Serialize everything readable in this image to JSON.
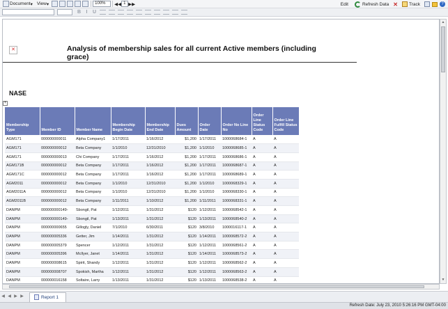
{
  "toolbar": {
    "document_label": "Document",
    "view_label": "View",
    "zoom_value": "100%",
    "page_number": "1",
    "edit_label": "Edit",
    "refresh_label": "Refresh Data",
    "track_label": "Track"
  },
  "report": {
    "title": "Analysis of membership sales for all current Active members (including grace)",
    "group_label": "NASE",
    "columns": [
      "Membership Type",
      "Member ID",
      "Member Name",
      "Membership Begin Date",
      "Membership End Date",
      "Dues Amount",
      "Order Date",
      "Order No Line No",
      "Order Line Status Code",
      "Order Line Fulfill Status Code"
    ],
    "rows": [
      [
        "AGM171",
        "000000000011",
        "Alpha Company1",
        "1/17/2011",
        "1/16/2012",
        "$1,200",
        "1/17/2011",
        "1000068684-1",
        "A",
        "A"
      ],
      [
        "AGM171",
        "000000000012",
        "Beta Company",
        "1/1/2010",
        "12/31/2010",
        "$1,200",
        "1/1/2010",
        "1000068685-1",
        "A",
        "A"
      ],
      [
        "AGM171",
        "000000000013",
        "Chi Company",
        "1/17/2011",
        "1/16/2012",
        "$1,200",
        "1/17/2011",
        "1000068686-1",
        "A",
        "A"
      ],
      [
        "AGM171B",
        "000000000012",
        "Beta Company",
        "1/17/2011",
        "1/16/2012",
        "$1,200",
        "1/17/2011",
        "1000068687-1",
        "A",
        "A"
      ],
      [
        "AGM171C",
        "000000000012",
        "Beta Company",
        "1/17/2011",
        "1/16/2012",
        "$1,200",
        "1/17/2011",
        "1000068689-1",
        "A",
        "A"
      ],
      [
        "AGM2011",
        "000000000012",
        "Beta Company",
        "1/1/2010",
        "12/31/2010",
        "$1,200",
        "1/1/2010",
        "1000068329-1",
        "A",
        "A"
      ],
      [
        "AGM2011A",
        "000000000012",
        "Beta Company",
        "1/1/2010",
        "12/31/2010",
        "$1,200",
        "1/1/2010",
        "1000068330-1",
        "A",
        "A"
      ],
      [
        "AGM2011B",
        "000000000012",
        "Beta Company",
        "1/11/2011",
        "1/10/2012",
        "$1,200",
        "1/11/2011",
        "1000068331-1",
        "A",
        "A"
      ],
      [
        "DANPM",
        "000000000149-",
        "Sbongil, Pat",
        "1/12/2011",
        "1/31/2012",
        "$120",
        "1/12/2011",
        "1000068542-1",
        "A",
        "A"
      ],
      [
        "DANPM",
        "000000000149-",
        "Sbongil, Pat",
        "1/13/2011",
        "1/31/2012",
        "$120",
        "1/13/2011",
        "1000068540-2",
        "A",
        "A"
      ],
      [
        "DANPM",
        "000000000655",
        "Gillogly, Daniel",
        "7/1/2010",
        "6/30/2011",
        "$120",
        "3/8/2010",
        "1000016117-1",
        "A",
        "A"
      ],
      [
        "DANPM",
        "000000005336",
        "Getter, Jim",
        "1/14/2011",
        "1/31/2012",
        "$120",
        "1/14/2011",
        "1000068572-2",
        "A",
        "A"
      ],
      [
        "DANPM",
        "000000005379",
        "Spencer",
        "1/12/2011",
        "1/31/2012",
        "$120",
        "1/12/2011",
        "1000068561-2",
        "A",
        "A"
      ],
      [
        "DANPM",
        "000000005396",
        "McIlyer, Janet",
        "1/14/2011",
        "1/31/2012",
        "$120",
        "1/14/2011",
        "1000068573-2",
        "A",
        "A"
      ],
      [
        "DANPM",
        "000000008615",
        "Spirit, Shandy",
        "1/12/2011",
        "1/31/2012",
        "$120",
        "1/12/2011",
        "1000068562-2",
        "A",
        "A"
      ],
      [
        "DANPM",
        "000000008707",
        "Spokish, Martha",
        "1/12/2011",
        "1/31/2012",
        "$120",
        "1/12/2011",
        "1000068563-2",
        "A",
        "A"
      ],
      [
        "DANPM",
        "000000016158",
        "Soltaire, Larry",
        "1/13/2011",
        "1/31/2012",
        "$120",
        "1/13/2011",
        "1000068538-2",
        "A",
        "A"
      ]
    ]
  },
  "tabs": {
    "report_tab_label": "Report 1"
  },
  "status": {
    "refresh_text": "Refresh Date: July 23, 2010 5:26:16 PM GMT-04:00"
  },
  "colors": {
    "header_bg": "#6b7bb7",
    "row_alt_bg": "#f0f2f7"
  }
}
